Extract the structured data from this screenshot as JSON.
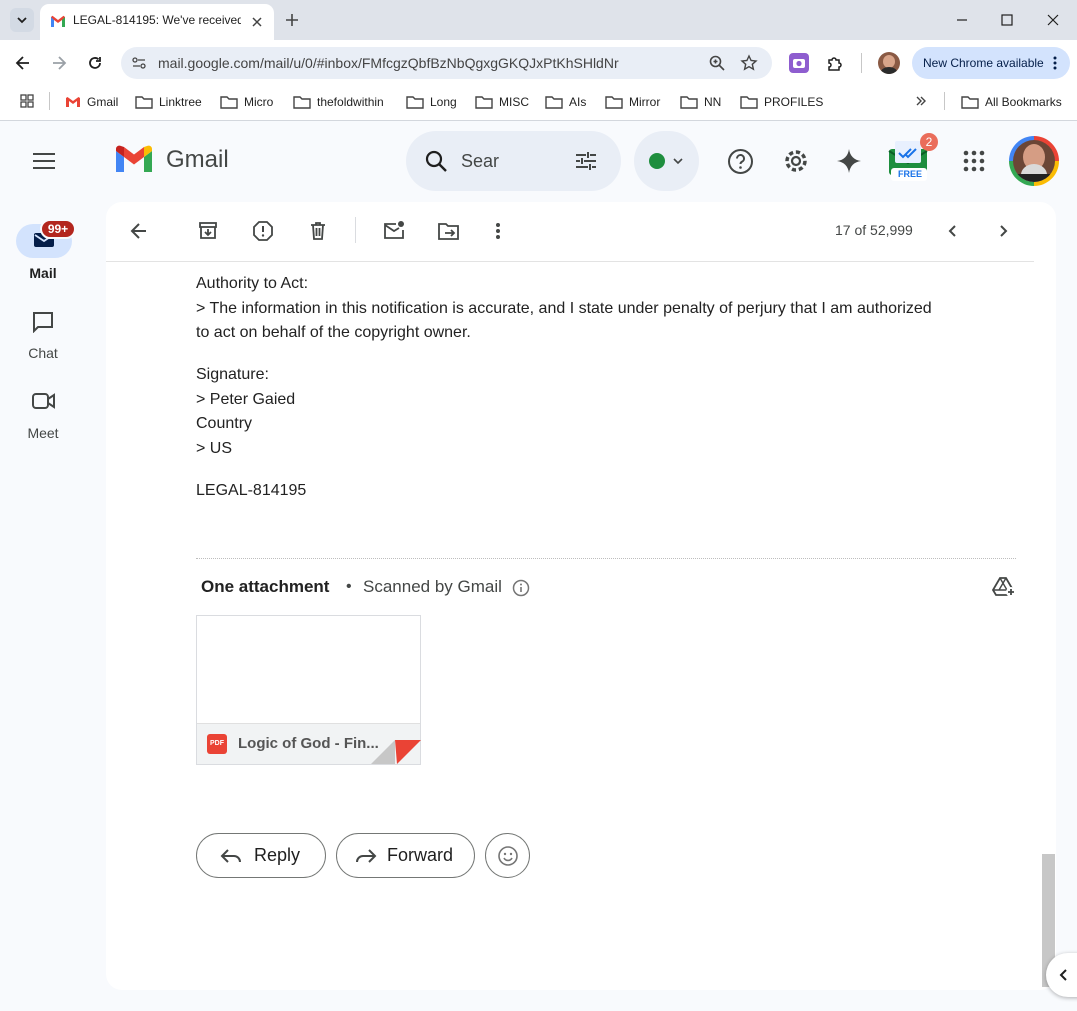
{
  "browser": {
    "tab_title": "LEGAL-814195: We've received",
    "url": "mail.google.com/mail/u/0/#inbox/FMfcgzQbfBzNbQgxgGKQJxPtKhSHldNr",
    "new_chrome_label": "New Chrome available",
    "bookmarks": [
      "Gmail",
      "Linktree",
      "Micro",
      "thefoldwithin",
      "Long",
      "MISC",
      "AIs",
      "Mirror",
      "NN",
      "PROFILES"
    ],
    "all_bookmarks_label": "All Bookmarks"
  },
  "gmail": {
    "logo_text": "Gmail",
    "search_placeholder": "Sear",
    "extension_badge_count": "2",
    "extension_badge_text": "FREE",
    "rail": {
      "mail_label": "Mail",
      "mail_badge": "99+",
      "chat_label": "Chat",
      "meet_label": "Meet"
    },
    "toolbar": {
      "pagination": "17 of 52,999"
    },
    "message": {
      "authority_heading": "Authority to Act:",
      "authority_line1": "> The information in this notification is accurate, and I state under penalty of perjury that I am authorized",
      "authority_line2": "to act on behalf of the copyright owner.",
      "signature_heading": "Signature:",
      "signature_value": "> Peter Gaied",
      "country_heading": "Country",
      "country_value": "> US",
      "reference": "LEGAL-814195"
    },
    "attachments": {
      "heading": "One attachment",
      "separator": "•",
      "scanned_label": "Scanned by Gmail",
      "file_name": "Logic of God - Fin...",
      "file_type": "PDF"
    },
    "actions": {
      "reply_label": "Reply",
      "forward_label": "Forward"
    }
  },
  "colors": {
    "chrome_bg": "#dfe3ea",
    "gmail_bg": "#f8fafd",
    "pill_bg": "#e9eef6",
    "badge_red": "#b3261e",
    "status_green": "#1e8e3e",
    "pdf_red": "#ea4335"
  }
}
